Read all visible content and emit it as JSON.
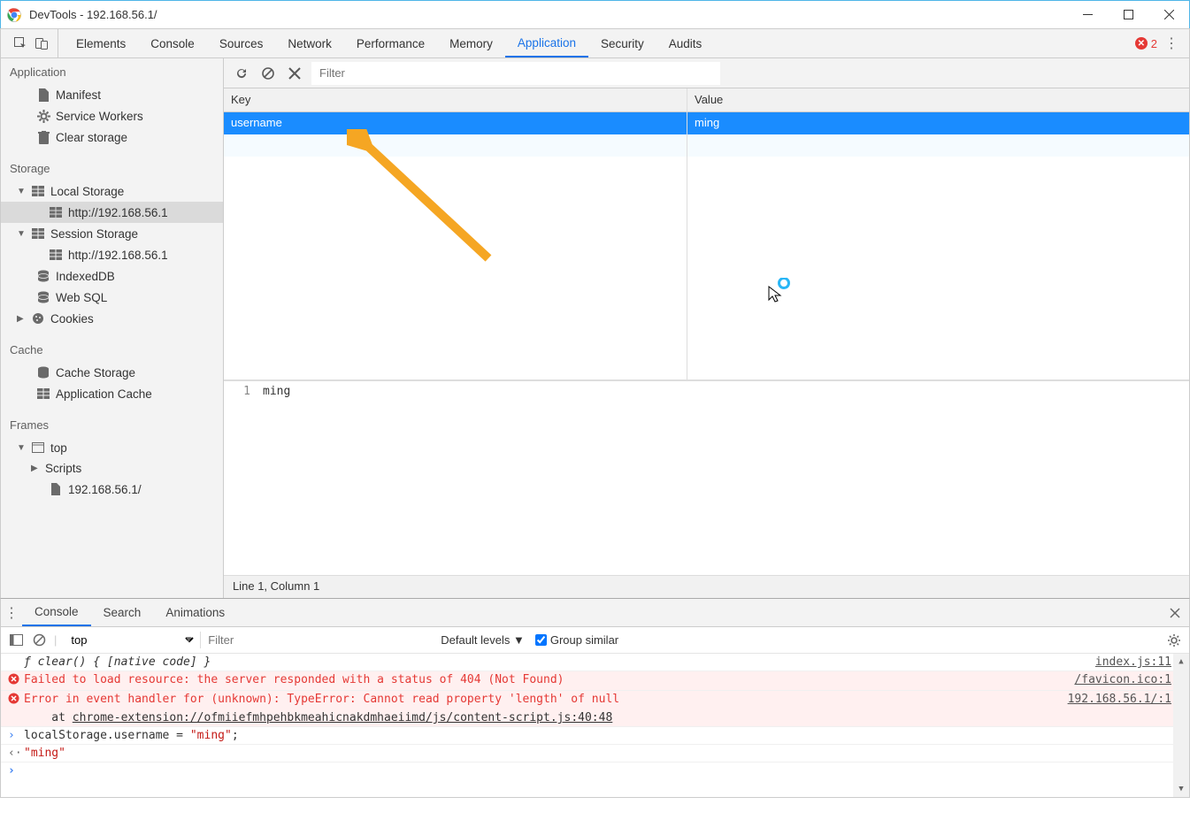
{
  "window": {
    "title": "DevTools - 192.168.56.1/"
  },
  "tabs": {
    "items": [
      "Elements",
      "Console",
      "Sources",
      "Network",
      "Performance",
      "Memory",
      "Application",
      "Security",
      "Audits"
    ],
    "active": "Application",
    "error_count": "2"
  },
  "sidebar": {
    "groups": {
      "application": {
        "title": "Application",
        "items": [
          "Manifest",
          "Service Workers",
          "Clear storage"
        ]
      },
      "storage": {
        "title": "Storage",
        "local_storage": {
          "label": "Local Storage",
          "child": "http://192.168.56.1"
        },
        "session_storage": {
          "label": "Session Storage",
          "child": "http://192.168.56.1"
        },
        "indexeddb": "IndexedDB",
        "websql": "Web SQL",
        "cookies": "Cookies"
      },
      "cache": {
        "title": "Cache",
        "items": [
          "Cache Storage",
          "Application Cache"
        ]
      },
      "frames": {
        "title": "Frames",
        "top": "top",
        "scripts": "Scripts",
        "page": "192.168.56.1/"
      }
    }
  },
  "filter": {
    "placeholder": "Filter"
  },
  "table": {
    "head_key": "Key",
    "head_value": "Value",
    "rows": [
      {
        "key": "username",
        "value": "ming"
      }
    ]
  },
  "preview": {
    "line_no": "1",
    "text": "ming",
    "status": "Line 1, Column 1"
  },
  "drawer": {
    "tabs": [
      "Console",
      "Search",
      "Animations"
    ],
    "active": "Console",
    "toolbar": {
      "context": "top",
      "filter_placeholder": "Filter",
      "levels": "Default levels ▼",
      "group": "Group similar"
    },
    "lines": {
      "l0": {
        "msg": "ƒ clear() { [native code] }",
        "src": "index.js:11"
      },
      "l1": {
        "msg": "Failed to load resource: the server responded with a status of 404 (Not Found)",
        "src": "/favicon.ico:1"
      },
      "l2": {
        "msg": "Error in event handler for (unknown): TypeError: Cannot read property 'length' of null",
        "src": "192.168.56.1/:1"
      },
      "l2b": {
        "prefix": "    at ",
        "trace": "chrome-extension://ofmiiefmhpehbkmeahicnakdmhaeiimd/js/content-script.js:40:48"
      },
      "l3": {
        "pre": "localStorage.username = ",
        "val": "\"ming\"",
        "post": ";"
      },
      "l4": {
        "val": "\"ming\""
      }
    }
  }
}
